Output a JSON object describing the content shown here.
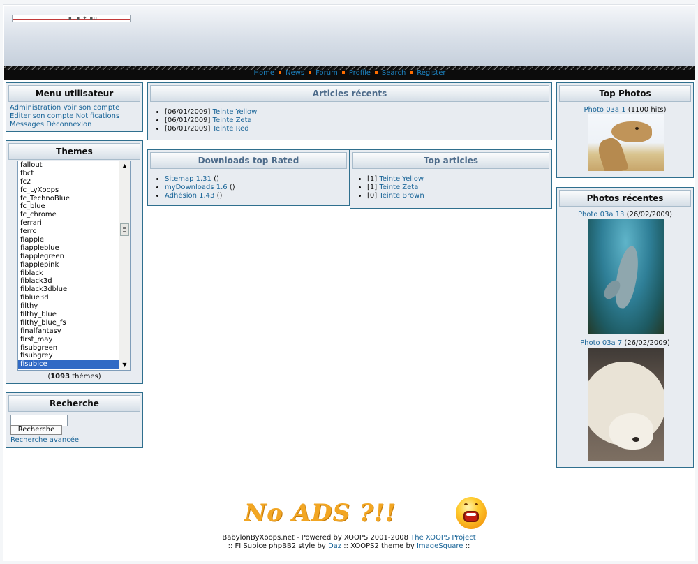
{
  "nav": {
    "links": [
      "Home",
      "News",
      "Forum",
      "Profile",
      "Search",
      "Register"
    ]
  },
  "user_menu": {
    "title": "Menu utilisateur",
    "links": [
      "Administration",
      "Voir son compte",
      "Editer son compte",
      "Notifications",
      "Messages",
      "Déconnexion"
    ]
  },
  "themes": {
    "title": "Themes",
    "options": [
      "fallout",
      "fbct",
      "fc2",
      "fc_LyXoops",
      "fc_TechnoBlue",
      "fc_blue",
      "fc_chrome",
      "ferrari",
      "ferro",
      "fiapple",
      "fiappleblue",
      "fiapplegreen",
      "fiapplepink",
      "fiblack",
      "fiblack3d",
      "fiblack3dblue",
      "fiblue3d",
      "filthy",
      "filthy_blue",
      "filthy_blue_fs",
      "finalfantasy",
      "first_may",
      "fisubgreen",
      "fisubgrey",
      "fisubice"
    ],
    "selected": "fisubice",
    "count": "1093",
    "count_suffix": "thèmes"
  },
  "search": {
    "title": "Recherche",
    "input_value": "",
    "button_label": "Recherche",
    "advanced_link": "Recherche avancée"
  },
  "recent_articles": {
    "title": "Articles récents",
    "items": [
      {
        "date": "[06/01/2009]",
        "title": "Teinte Yellow"
      },
      {
        "date": "[06/01/2009]",
        "title": "Teinte Zeta"
      },
      {
        "date": "[06/01/2009]",
        "title": "Teinte Red"
      }
    ]
  },
  "downloads_top": {
    "title": "Downloads top Rated",
    "items": [
      {
        "name": "Sitemap 1.31",
        "suffix": "()"
      },
      {
        "name": "myDownloads 1.6",
        "suffix": "()"
      },
      {
        "name": "Adhésion 1.43",
        "suffix": "()"
      }
    ]
  },
  "top_articles": {
    "title": "Top articles",
    "items": [
      {
        "count": "[1]",
        "title": "Teinte Yellow"
      },
      {
        "count": "[1]",
        "title": "Teinte Zeta"
      },
      {
        "count": "[0]",
        "title": "Teinte Brown"
      }
    ]
  },
  "top_photos": {
    "title": "Top Photos",
    "items": [
      {
        "title": "Photo 03a 1",
        "meta": "(1100 hits)"
      }
    ]
  },
  "recent_photos": {
    "title": "Photos récentes",
    "items": [
      {
        "title": "Photo 03a 13",
        "meta": "(26/02/2009)"
      },
      {
        "title": "Photo 03a 7",
        "meta": "(26/02/2009)"
      }
    ]
  },
  "footer": {
    "banner_text": "No ADS ?!!",
    "line1_prefix": "BabylonByXoops.net - Powered by XOOPS 2001-2008",
    "line1_link": "The XOOPS Project",
    "line2_prefix": ":: FI Subice phpBB2 style by",
    "line2_link1": "Daz",
    "line2_mid": ":: XOOPS2 theme by",
    "line2_link2": "ImageSquare",
    "line2_suffix": "::"
  },
  "colors": {
    "link": "#1a6598",
    "block_border": "#2f6f8e",
    "block_bg": "#e8ecf1",
    "nav_bg": "#0c0c0c",
    "nav_separator": "#ff6e00",
    "selected_option": "#316ac5"
  }
}
